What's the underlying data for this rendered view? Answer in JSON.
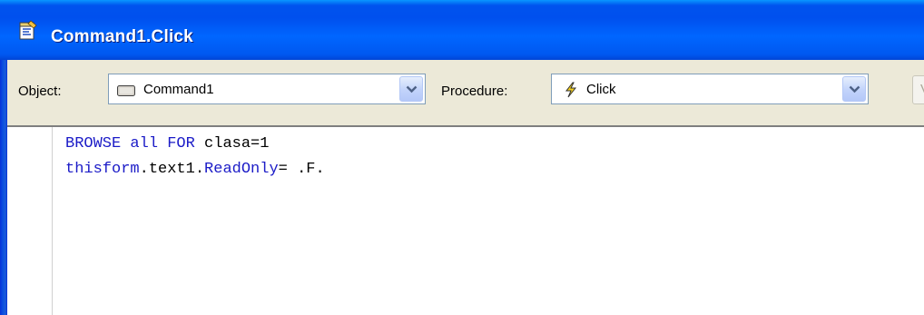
{
  "window": {
    "title": "Command1.Click"
  },
  "toolbar": {
    "object_label": "Object:",
    "object_value": "Command1",
    "procedure_label": "Procedure:",
    "procedure_value": "Click",
    "truncated_button_text": "V"
  },
  "code": {
    "line1": {
      "kw1": "BROWSE",
      "kw2": "all",
      "kw3": "FOR",
      "rest": "clasa=1"
    },
    "line2": {
      "kw1": "thisform",
      "mid": ".text1.",
      "kw2": "ReadOnly",
      "rest": "= .F."
    }
  },
  "colors": {
    "keyword": "#1b1bc7",
    "titlebar": "#0058f0",
    "toolbar_bg": "#ece9d8"
  }
}
